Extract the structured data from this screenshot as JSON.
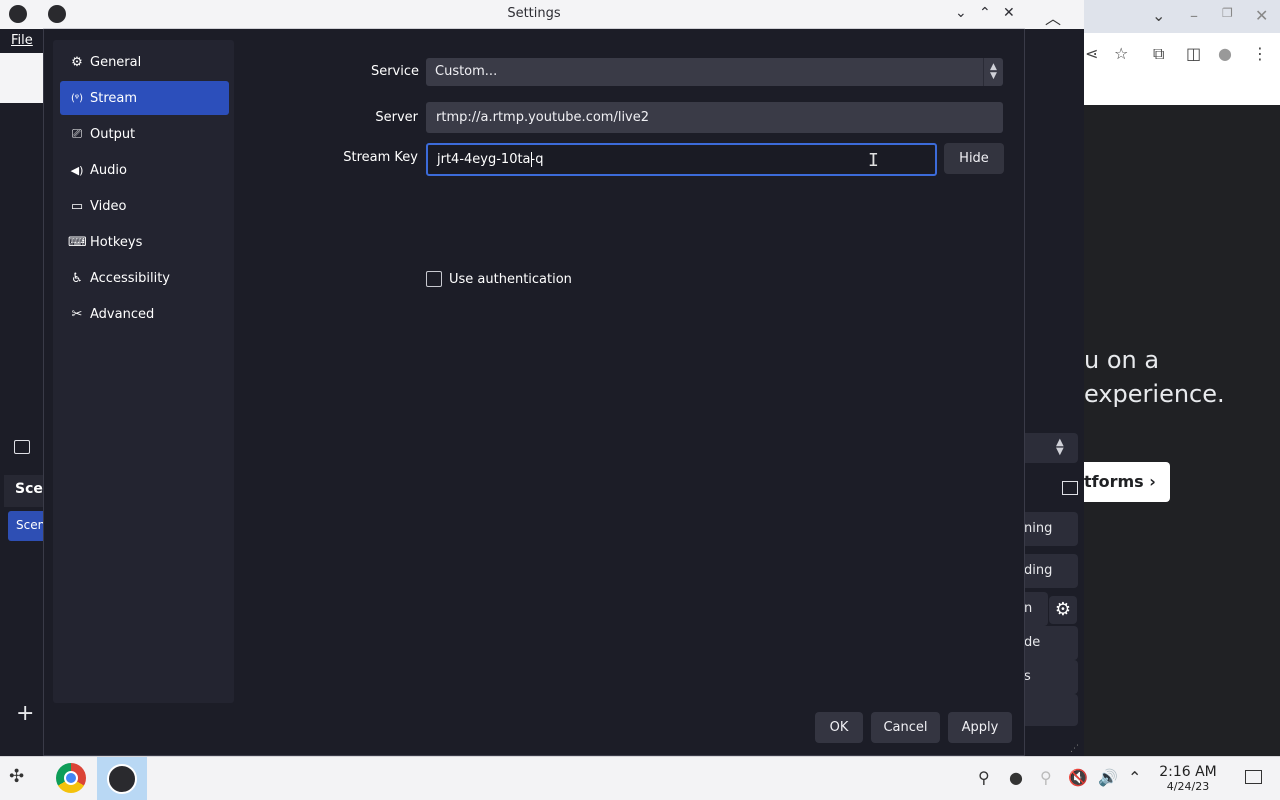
{
  "obs_main": {
    "menu_file": "File",
    "scene_header": "Scenes",
    "scene_item": "Scene",
    "controls": [
      {
        "label": "Start Streaming",
        "visible_fragment": "ning"
      },
      {
        "label": "Start Recording",
        "visible_fragment": "ding"
      },
      {
        "label": "Start Virtual Camera",
        "visible_fragment": "n"
      },
      {
        "label": "Studio Mode",
        "visible_fragment": "de"
      },
      {
        "label": "Settings",
        "visible_fragment": "s"
      }
    ]
  },
  "chrome": {
    "headline_line1": "u on a",
    "headline_line2": "experience.",
    "platforms_button": "tforms"
  },
  "dialog": {
    "title": "Settings",
    "sidebar": [
      {
        "label": "General",
        "icon": "gear-icon",
        "glyph": "⚙"
      },
      {
        "label": "Stream",
        "icon": "antenna-icon",
        "glyph": "((·))",
        "active": true
      },
      {
        "label": "Output",
        "icon": "output-icon",
        "glyph": "▭"
      },
      {
        "label": "Audio",
        "icon": "speaker-icon",
        "glyph": "🔊"
      },
      {
        "label": "Video",
        "icon": "monitor-icon",
        "glyph": "▭"
      },
      {
        "label": "Hotkeys",
        "icon": "keyboard-icon",
        "glyph": "⌨"
      },
      {
        "label": "Accessibility",
        "icon": "accessibility-icon",
        "glyph": "♿"
      },
      {
        "label": "Advanced",
        "icon": "tools-icon",
        "glyph": "✂"
      }
    ],
    "form": {
      "service_label": "Service",
      "service_value": "Custom...",
      "server_label": "Server",
      "server_value": "rtmp://a.rtmp.youtube.com/live2",
      "stream_key_label": "Stream Key",
      "stream_key_value": "jrt4-4eyg-10ta-q",
      "hide_button": "Hide",
      "use_auth_label": "Use authentication",
      "use_auth_checked": false
    },
    "buttons": {
      "ok": "OK",
      "cancel": "Cancel",
      "apply": "Apply"
    }
  },
  "taskbar": {
    "time": "2:16 AM",
    "date": "4/24/23"
  },
  "colors": {
    "accent": "#2c4fbb",
    "focus_border": "#3c6bd9",
    "dialog_bg": "#1c1d27"
  }
}
